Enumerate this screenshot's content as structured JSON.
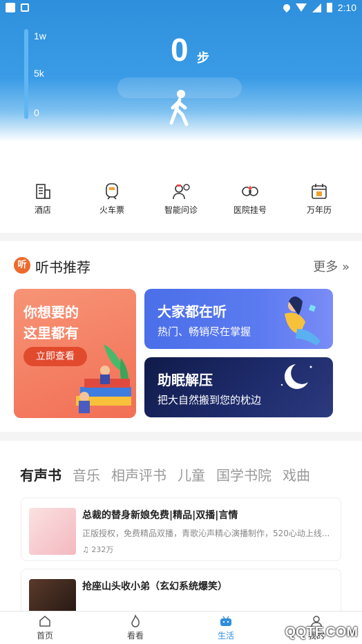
{
  "status_bar": {
    "time": "2:10"
  },
  "pedometer": {
    "gauge_labels": [
      "1w",
      "5k",
      "0"
    ],
    "steps": "0",
    "steps_unit": "步",
    "progress_fraction": 0
  },
  "services": [
    {
      "label": "酒店",
      "icon": "hotel-icon"
    },
    {
      "label": "火车票",
      "icon": "train-icon"
    },
    {
      "label": "智能问诊",
      "icon": "doctor-icon"
    },
    {
      "label": "医院挂号",
      "icon": "hospital-icon"
    },
    {
      "label": "万年历",
      "icon": "calendar-icon"
    }
  ],
  "listen_section": {
    "logo_text": "听",
    "title": "听书推荐",
    "more_label": "更多 »",
    "promo": {
      "line1": "你想要的",
      "line2": "这里都有",
      "button": "立即查看"
    },
    "card_hot": {
      "title": "大家都在听",
      "subtitle": "热门、畅销尽在掌握"
    },
    "card_sleep": {
      "title": "助眠解压",
      "subtitle": "把大自然搬到您的枕边"
    }
  },
  "category_tabs": [
    "有声书",
    "音乐",
    "相声评书",
    "儿童",
    "国学书院",
    "戏曲"
  ],
  "books": [
    {
      "title": "总裁的替身新娘免费|精品|双播|言情",
      "description": "正版授权，免费精品双播，青歌沁声精心演播制作，520心动上线...",
      "play_count": "232万",
      "cover_color": "#f3c8c8"
    },
    {
      "title": "抢座山头收小弟（玄幻系统爆笑）",
      "description": "",
      "play_count": "",
      "cover_color": "#3a2a22"
    }
  ],
  "bottom_nav": [
    {
      "label": "首页",
      "icon": "home-icon",
      "active": false
    },
    {
      "label": "看看",
      "icon": "flame-icon",
      "active": false
    },
    {
      "label": "生活",
      "icon": "life-icon",
      "active": true
    },
    {
      "label": "我的",
      "icon": "profile-icon",
      "active": false
    }
  ],
  "watermark": "QQTF.COM",
  "colors": {
    "primary": "#2e8fdc",
    "promo_orange": "#f26f55",
    "logo_orange": "#ee6a2c"
  }
}
